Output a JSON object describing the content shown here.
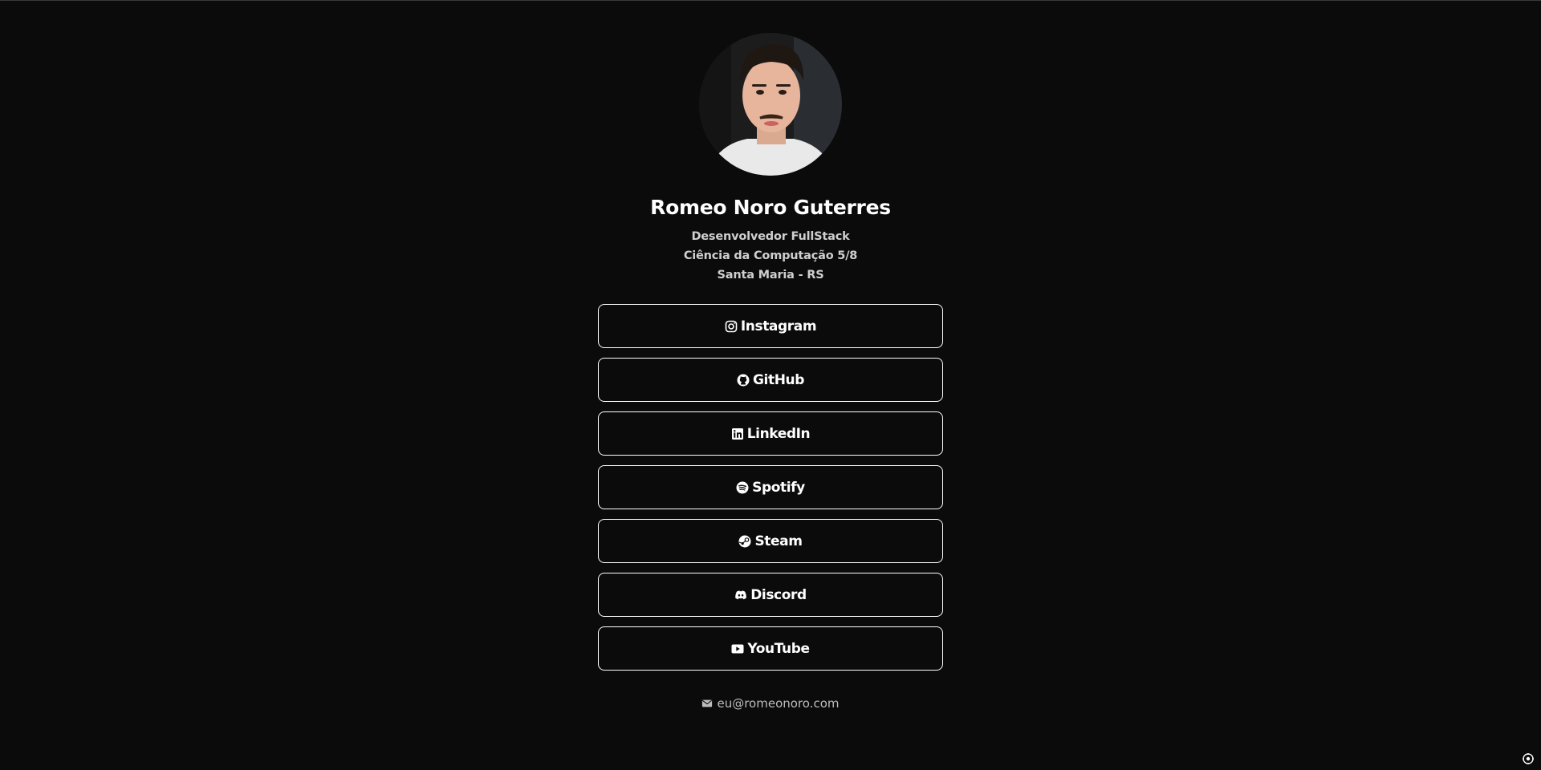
{
  "profile": {
    "name": "Romeo Noro Guterres",
    "lines": [
      "Desenvolvedor FullStack",
      "Ciência da Computação 5/8",
      "Santa Maria - RS"
    ]
  },
  "links": [
    {
      "label": "Instagram",
      "icon": "instagram-icon"
    },
    {
      "label": "GitHub",
      "icon": "github-icon"
    },
    {
      "label": "LinkedIn",
      "icon": "linkedin-icon"
    },
    {
      "label": "Spotify",
      "icon": "spotify-icon"
    },
    {
      "label": "Steam",
      "icon": "steam-icon"
    },
    {
      "label": "Discord",
      "icon": "discord-icon"
    },
    {
      "label": "YouTube",
      "icon": "youtube-icon"
    }
  ],
  "contact": {
    "email": "eu@romeonoro.com",
    "icon": "envelope-icon"
  },
  "colors": {
    "background": "#0b0b0b",
    "text": "#ffffff",
    "muted": "#cfcfcf",
    "border": "#ffffff"
  }
}
